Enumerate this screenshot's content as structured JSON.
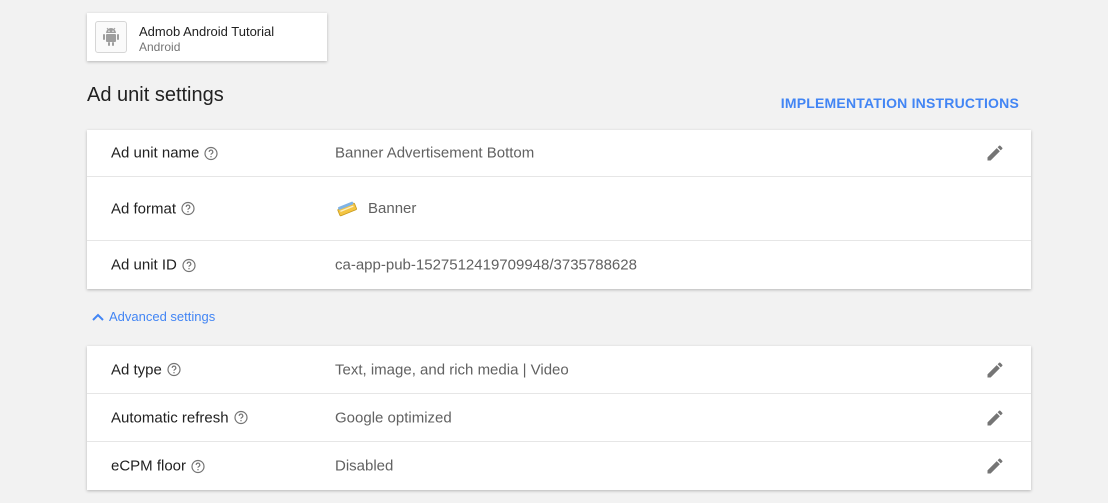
{
  "app": {
    "name": "Admob Android Tutorial",
    "platform": "Android",
    "icon": "android-icon"
  },
  "page": {
    "title": "Ad unit settings",
    "impl_link": "IMPLEMENTATION INSTRUCTIONS"
  },
  "main_rows": [
    {
      "label": "Ad unit name",
      "value": "Banner Advertisement Bottom",
      "editable": true
    },
    {
      "label": "Ad format",
      "value": "Banner",
      "icon": "banner-format-icon",
      "editable": false
    },
    {
      "label": "Ad unit ID",
      "value": "ca-app-pub-1527512419709948/3735788628",
      "editable": false
    }
  ],
  "advanced": {
    "toggle_label": "Advanced settings",
    "expanded": true,
    "rows": [
      {
        "label": "Ad type",
        "value": "Text, image, and rich media | Video",
        "editable": true
      },
      {
        "label": "Automatic refresh",
        "value": "Google optimized",
        "editable": true
      },
      {
        "label": "eCPM floor",
        "value": "Disabled",
        "editable": true
      }
    ]
  },
  "colors": {
    "accent": "#4285f4",
    "background": "#f2f2f2",
    "icon_gray": "#757575"
  }
}
